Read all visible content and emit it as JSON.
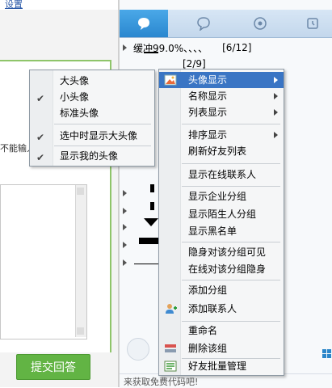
{
  "left": {
    "settings_link": "设置",
    "cant_input": "不能输入",
    "submit_button": "提交回答"
  },
  "qq": {
    "groups": [
      {
        "label": "缓冲99.0%、、、、",
        "count": "[6/12]"
      },
      {
        "label": "",
        "count": "[2/9]"
      }
    ],
    "bottom_text": "来获取免费代码吧!"
  },
  "submenu": {
    "items": [
      {
        "label": "大头像",
        "checked": false
      },
      {
        "label": "小头像",
        "checked": true
      },
      {
        "label": "标准头像",
        "checked": false
      },
      {
        "label": "选中时显示大头像",
        "checked": true
      },
      {
        "label": "显示我的头像",
        "checked": true
      }
    ]
  },
  "mainmenu": {
    "items": [
      {
        "label": "头像显示",
        "submenu": true,
        "highlighted": true,
        "icon": "avatar-display-icon"
      },
      {
        "label": "名称显示",
        "submenu": true
      },
      {
        "label": "列表显示",
        "submenu": true
      },
      {
        "label": "排序显示",
        "submenu": true
      },
      {
        "label": "刷新好友列表"
      },
      {
        "label": "显示在线联系人"
      },
      {
        "label": "显示企业分组"
      },
      {
        "label": "显示陌生人分组"
      },
      {
        "label": "显示黑名单"
      },
      {
        "label": "隐身对该分组可见"
      },
      {
        "label": "在线对该分组隐身"
      },
      {
        "label": "添加分组"
      },
      {
        "label": "添加联系人",
        "icon": "add-contact-icon"
      },
      {
        "label": "重命名"
      },
      {
        "label": "删除该组",
        "icon": "delete-group-icon"
      },
      {
        "label": "好友批量管理",
        "icon": "batch-manage-icon"
      }
    ]
  },
  "colors": {
    "highlight": "#3a75c4",
    "submit_green": "#62b444",
    "tab_active": "#2a87cf"
  }
}
